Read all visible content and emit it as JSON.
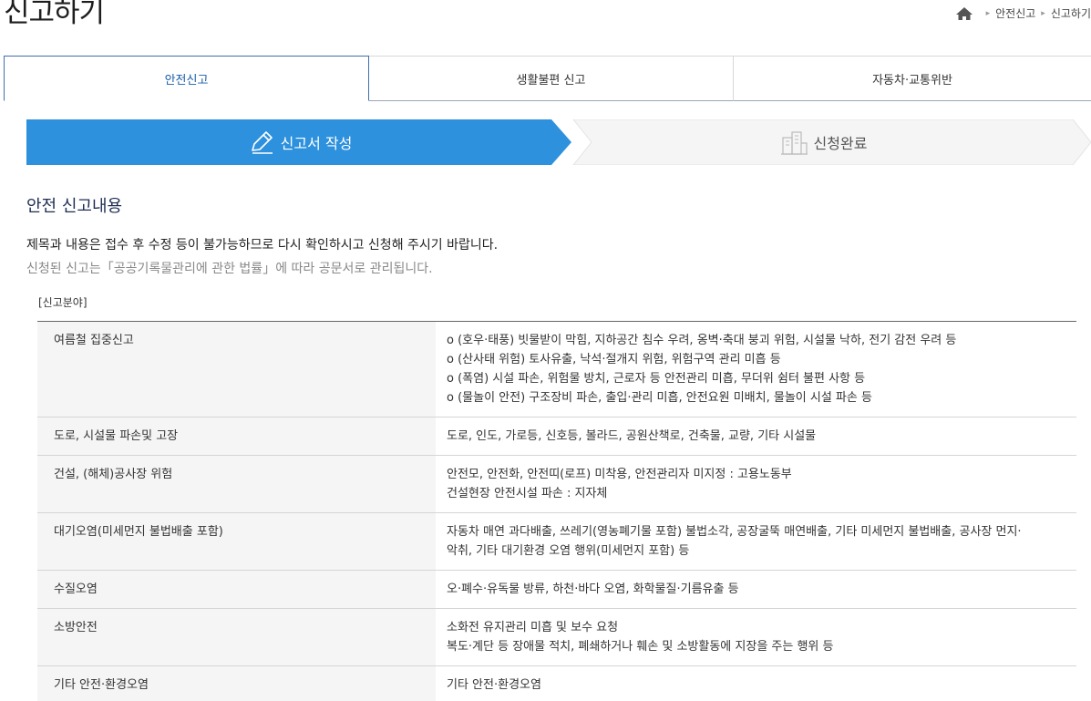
{
  "page": {
    "title": "신고하기"
  },
  "breadcrumb": {
    "item1": "안전신고",
    "item2": "신고하기"
  },
  "tabs": [
    {
      "label": "안전신고"
    },
    {
      "label": "생활불편 신고"
    },
    {
      "label": "자동차·교통위반"
    }
  ],
  "steps": {
    "step1": "신고서 작성",
    "step2": "신청완료"
  },
  "section": {
    "title": "안전 신고내용",
    "notice_main": "제목과 내용은 접수 후 수정 등이 불가능하므로 다시 확인하시고 신청해 주시기 바랍니다.",
    "notice_sub": "신청된 신고는「공공기록물관리에 관한 법률」에 따라 공문서로 관리됩니다.",
    "field_label": "[신고분야]"
  },
  "categories": [
    {
      "name": "여름철 집중신고",
      "lines": [
        "o (호우·태풍) 빗물받이 막힘, 지하공간 침수 우려, 옹벽·축대 붕괴 위험, 시설물 낙하, 전기 감전 우려 등",
        "o (산사태 위험) 토사유출, 낙석·절개지 위험, 위험구역 관리 미흡 등",
        "o (폭염) 시설 파손, 위험물 방치, 근로자 등 안전관리 미흡, 무더위 쉼터 불편 사항 등",
        "o (물놀이 안전) 구조장비 파손, 출입·관리 미흡, 안전요원 미배치, 물놀이 시설 파손 등"
      ]
    },
    {
      "name": "도로, 시설물 파손및 고장",
      "lines": [
        "도로, 인도, 가로등, 신호등, 볼라드, 공원산책로, 건축물, 교량, 기타 시설물"
      ]
    },
    {
      "name": "건설, (해체)공사장 위험",
      "lines": [
        "안전모, 안전화, 안전띠(로프) 미착용, 안전관리자 미지정 : 고용노동부",
        "건설현장 안전시설 파손 : 지자체"
      ]
    },
    {
      "name": "대기오염(미세먼지 불법배출 포함)",
      "lines": [
        "자동차 매연 과다배출, 쓰레기(영농폐기물 포함) 불법소각, 공장굴뚝 매연배출, 기타 미세먼지 불법배출, 공사장 먼지·",
        "악취, 기타 대기환경 오염 행위(미세먼지 포함) 등"
      ]
    },
    {
      "name": "수질오염",
      "lines": [
        "오·폐수·유독물 방류, 하천·바다 오염, 화학물질·기름유출 등"
      ]
    },
    {
      "name": "소방안전",
      "lines": [
        "소화전 유지관리 미흡 및 보수 요청",
        "복도·계단 등 장애물 적치, 폐쇄하거나 훼손 및 소방활동에 지장을 주는 행위 등"
      ]
    },
    {
      "name": "기타 안전·환경오염",
      "lines": [
        "기타 안전·환경오염"
      ]
    }
  ],
  "colors": {
    "step_active": "#2e91dd",
    "tab_active_text": "#1a5ea8",
    "section_title": "#1c2c52"
  }
}
